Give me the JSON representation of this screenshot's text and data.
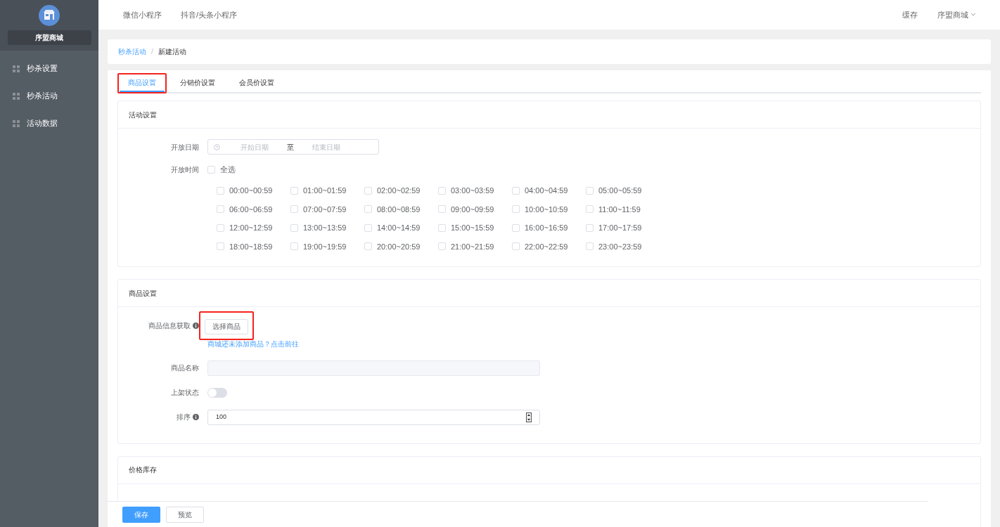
{
  "sidebar": {
    "shop_name": "序盟商城",
    "items": [
      {
        "label": "秒杀设置"
      },
      {
        "label": "秒杀活动"
      },
      {
        "label": "活动数据"
      }
    ]
  },
  "top_nav": {
    "links": [
      "微信小程序",
      "抖音/头条小程序"
    ],
    "cache": "缓存",
    "account": "序盟商城"
  },
  "breadcrumb": {
    "parent": "秒杀活动",
    "separator": "/",
    "current": "新建活动"
  },
  "tabs": [
    {
      "label": "商品设置",
      "selected": true,
      "highlighted": true
    },
    {
      "label": "分销价设置",
      "selected": false,
      "highlighted": false
    },
    {
      "label": "会员价设置",
      "selected": false,
      "highlighted": false
    }
  ],
  "activity_card": {
    "title": "活动设置",
    "date": {
      "label": "开放日期",
      "start_placeholder": "开始日期",
      "separator": "至",
      "end_placeholder": "结束日期"
    },
    "time": {
      "label": "开放时间",
      "select_all": {
        "label": "全选",
        "checked": false
      },
      "slots": [
        {
          "label": "00:00~00:59",
          "checked": false
        },
        {
          "label": "01:00~01:59",
          "checked": false
        },
        {
          "label": "02:00~02:59",
          "checked": false
        },
        {
          "label": "03:00~03:59",
          "checked": false
        },
        {
          "label": "04:00~04:59",
          "checked": false
        },
        {
          "label": "05:00~05:59",
          "checked": false
        },
        {
          "label": "06:00~06:59",
          "checked": false
        },
        {
          "label": "07:00~07:59",
          "checked": false
        },
        {
          "label": "08:00~08:59",
          "checked": false
        },
        {
          "label": "09:00~09:59",
          "checked": false
        },
        {
          "label": "10:00~10:59",
          "checked": false
        },
        {
          "label": "11:00~11:59",
          "checked": false
        },
        {
          "label": "12:00~12:59",
          "checked": false
        },
        {
          "label": "13:00~13:59",
          "checked": false
        },
        {
          "label": "14:00~14:59",
          "checked": false
        },
        {
          "label": "15:00~15:59",
          "checked": false
        },
        {
          "label": "16:00~16:59",
          "checked": false
        },
        {
          "label": "17:00~17:59",
          "checked": false
        },
        {
          "label": "18:00~18:59",
          "checked": false
        },
        {
          "label": "19:00~19:59",
          "checked": false
        },
        {
          "label": "20:00~20:59",
          "checked": false
        },
        {
          "label": "21:00~21:59",
          "checked": false
        },
        {
          "label": "22:00~22:59",
          "checked": false
        },
        {
          "label": "23:00~23:59",
          "checked": false
        }
      ]
    }
  },
  "goods_card": {
    "title": "商品设置",
    "source": {
      "label": "商品信息获取",
      "button": "选择商品",
      "button_highlighted": true,
      "hint": "商城还未添加商品？点击前往"
    },
    "name": {
      "label": "商品名称",
      "disabled": true
    },
    "listing": {
      "label": "上架状态",
      "on": false
    },
    "sort": {
      "label": "排序",
      "value": "100"
    }
  },
  "price_card": {
    "title": "价格库存"
  },
  "footer": {
    "save": "保存",
    "preview": "预览"
  }
}
